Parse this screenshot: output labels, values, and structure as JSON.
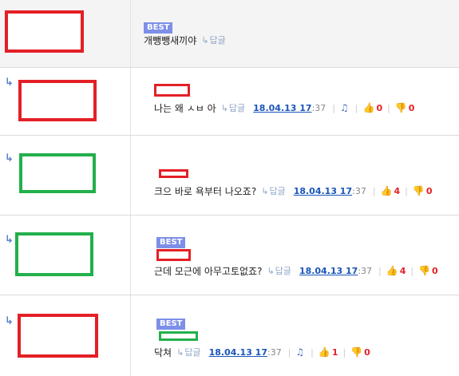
{
  "comments": [
    {
      "best_label": "BEST",
      "text": "개뺑뺑새끼야",
      "reply_label": "답글"
    },
    {
      "text": "나는 왜 ㅅㅂ 아",
      "reply_label": "답글",
      "date": "18.04.13 17",
      "time_suffix": ":37",
      "up": "0",
      "down": "0"
    },
    {
      "text": "크으 바로 욕부터 나오죠?",
      "reply_label": "답글",
      "date": "18.04.13 17",
      "time_suffix": ":37",
      "up": "4",
      "down": "0"
    },
    {
      "best_label": "BEST",
      "text": "근데 모근에 아무고토없죠?",
      "reply_label": "답글",
      "date": "18.04.13 17",
      "time_suffix": ":37",
      "up": "4",
      "down": "0"
    },
    {
      "best_label": "BEST",
      "text": "닥쳐",
      "reply_label": "답글",
      "date": "18.04.13 17",
      "time_suffix": ":37",
      "up": "1",
      "down": "0"
    }
  ],
  "icons": {
    "reply_arrow": "reply-arrow-icon",
    "thumbs_up": "thumbs-up-icon",
    "thumbs_down": "thumbs-down-icon",
    "report": "bell-icon"
  },
  "colors": {
    "best_badge": "#7d8fe8",
    "redact_red": "#e32026",
    "redact_green": "#22b04b",
    "date_link": "#1a55b8",
    "vote_count": "#e32026"
  }
}
